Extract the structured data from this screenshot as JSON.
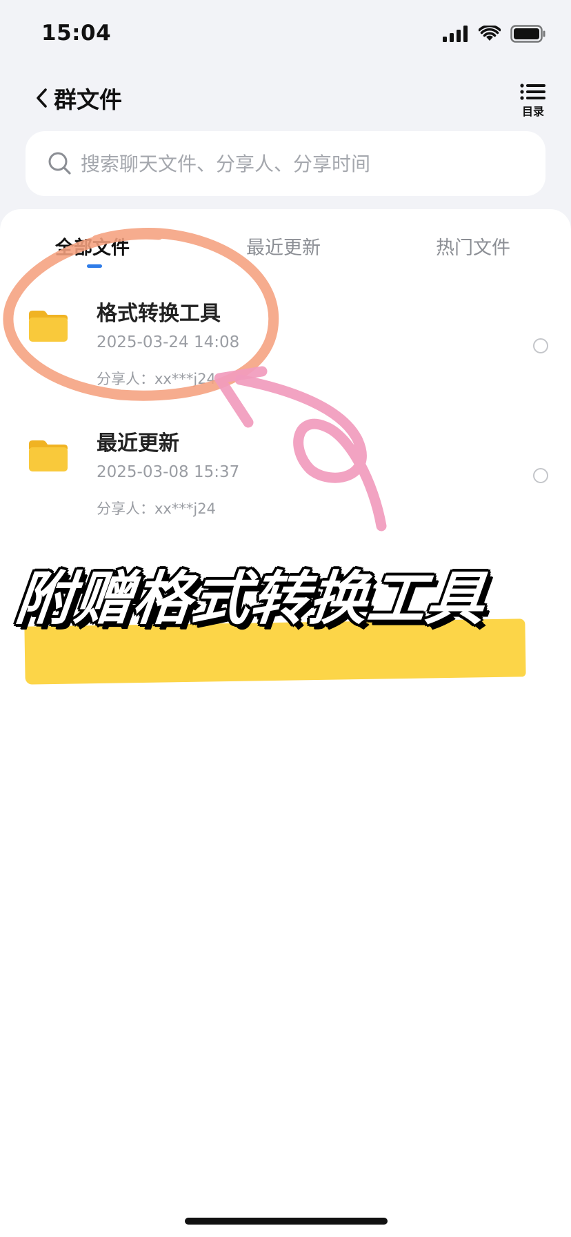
{
  "status_bar": {
    "time": "15:04"
  },
  "header": {
    "title": "群文件",
    "toc_label": "目录"
  },
  "search": {
    "placeholder": "搜索聊天文件、分享人、分享时间"
  },
  "tabs": [
    {
      "label": "全部文件",
      "active": true
    },
    {
      "label": "最近更新",
      "active": false
    },
    {
      "label": "热门文件",
      "active": false
    }
  ],
  "files": [
    {
      "name": "格式转换工具",
      "date": "2025-03-24 14:08",
      "sharer": "分享人：xx***j24",
      "icon": "folder-icon"
    },
    {
      "name": "最近更新",
      "date": "2025-03-08 15:37",
      "sharer": "分享人：xx***j24",
      "icon": "folder-icon"
    }
  ],
  "overlay": {
    "promo_text": "附赠格式转换工具",
    "highlight_color": "#fcd548",
    "circle_color": "#f5a07e",
    "arrow_color": "#f19bbd"
  },
  "colors": {
    "accent": "#2f7ce8",
    "folder": "#f9c93b",
    "background": "#f2f3f7"
  }
}
